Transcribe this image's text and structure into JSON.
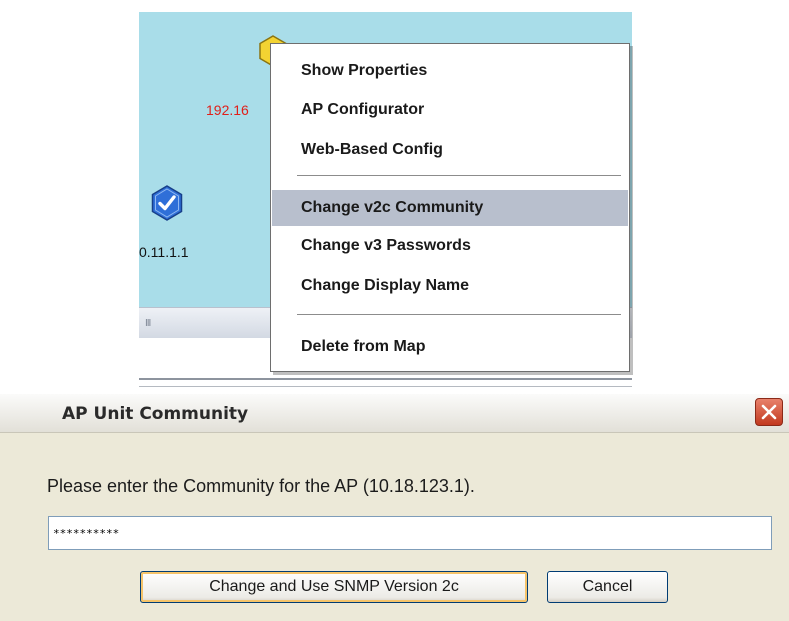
{
  "map": {
    "node_label_partial": "192.16",
    "node_label_left": "0.11.1.1",
    "scroll_grip": "III"
  },
  "context_menu": {
    "items": [
      {
        "label": "Show Properties"
      },
      {
        "label": "AP Configurator"
      },
      {
        "label": "Web-Based Config"
      },
      {
        "label": "Change v2c Community",
        "highlighted": true
      },
      {
        "label": "Change v3 Passwords"
      },
      {
        "label": "Change Display Name"
      },
      {
        "label": "Delete from Map"
      }
    ]
  },
  "dialog": {
    "title": "AP Unit Community",
    "prompt": "Please enter the Community for the AP (10.18.123.1).",
    "community_value": "**********",
    "ok_label": "Change and Use SNMP Version 2c",
    "cancel_label": "Cancel"
  },
  "icons": {
    "close": "close-icon",
    "node_blue": "checkmark-hexagon-icon",
    "node_yellow": "hexagon-icon"
  },
  "colors": {
    "map_background": "#a9dde9",
    "menu_highlight": "#b8bfcd",
    "node_label_red": "#e0201a",
    "close_button": "#c2391f"
  }
}
